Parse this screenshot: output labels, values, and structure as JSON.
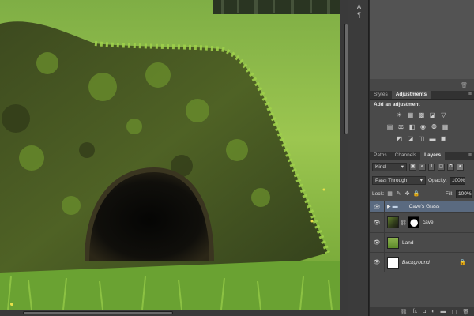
{
  "panels": {
    "adjustments": {
      "tabs": [
        "Styles",
        "Adjustments"
      ],
      "active_tab": "Adjustments",
      "title": "Add an adjustment"
    },
    "layers": {
      "tabs": [
        "Paths",
        "Channels",
        "Layers"
      ],
      "active_tab": "Layers",
      "filter_kind": "Kind",
      "blend_mode": "Pass Through",
      "opacity_label": "Opacity:",
      "opacity_value": "100%",
      "lock_label": "Lock:",
      "fill_label": "Fill:",
      "fill_value": "100%",
      "items": [
        {
          "name": "Cave's Grass",
          "type": "group",
          "selected": true
        },
        {
          "name": "cave",
          "type": "masked-layer"
        },
        {
          "name": "Land",
          "type": "layer"
        },
        {
          "name": "Background",
          "type": "background",
          "locked": true
        }
      ]
    }
  },
  "icons": {
    "visibility": "eye-icon",
    "group": "folder-icon",
    "lock": "lock-icon",
    "link": "chain-icon",
    "fx": "fx-icon",
    "trash": "trash-icon"
  },
  "colors": {
    "selected_layer": "#5a6a80",
    "panel_bg": "#4a4a4a",
    "tab_bar": "#323232"
  }
}
